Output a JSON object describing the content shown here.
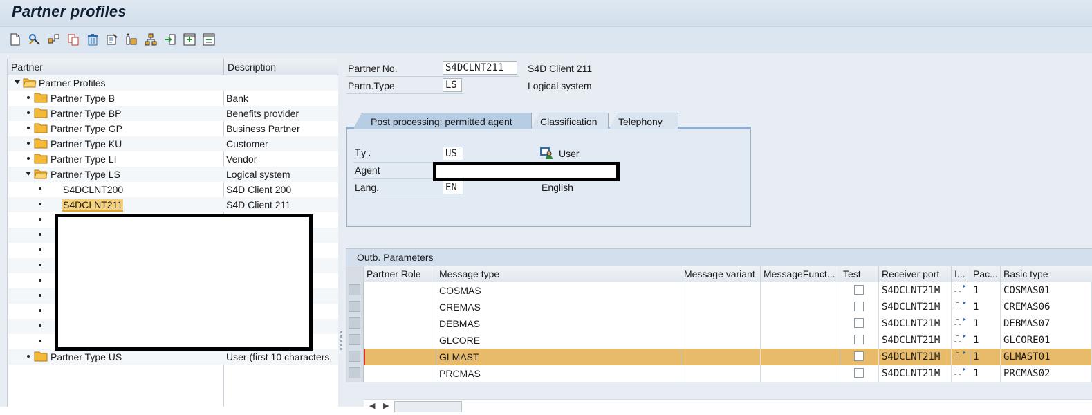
{
  "window": {
    "title": "Partner profiles"
  },
  "toolbar": {
    "buttons": [
      "create-icon",
      "change-icon",
      "display-icon",
      "copy-icon",
      "delete-icon",
      "check-icon",
      "info-icon",
      "hierarchy-icon",
      "import-icon",
      "expand-icon",
      "collapse-icon"
    ]
  },
  "tree": {
    "col_partner": "Partner",
    "col_description": "Description",
    "root": "Partner Profiles",
    "items": [
      {
        "label": "Partner Type B",
        "desc": "Bank"
      },
      {
        "label": "Partner Type BP",
        "desc": "Benefits provider"
      },
      {
        "label": "Partner Type GP",
        "desc": "Business Partner"
      },
      {
        "label": "Partner Type KU",
        "desc": "Customer"
      },
      {
        "label": "Partner Type LI",
        "desc": "Vendor"
      },
      {
        "label": "Partner Type LS",
        "desc": "Logical system"
      },
      {
        "label": "Partner Type US",
        "desc": "User (first 10 characters,"
      }
    ],
    "ls_children": [
      {
        "label": "S4DCLNT200",
        "desc": "S4D Client 200"
      },
      {
        "label": "S4DCLNT211",
        "desc": "S4D Client 211"
      }
    ]
  },
  "header": {
    "partner_no_label": "Partner No.",
    "partner_no_value": "S4DCLNT211",
    "partner_no_text": "S4D Client 211",
    "partn_type_label": "Partn.Type",
    "partn_type_value": "LS",
    "partn_type_text": "Logical system"
  },
  "tabs": {
    "items": [
      "Post processing: permitted agent",
      "Classification",
      "Telephony"
    ],
    "active": 0
  },
  "agent": {
    "ty_label": "Ty.",
    "ty_value": "US",
    "ty_text": "User",
    "agent_label": "Agent",
    "lang_label": "Lang.",
    "lang_value": "EN",
    "lang_text": "English"
  },
  "outbound": {
    "title": "Outb. Parameters",
    "columns": [
      "Partner Role",
      "Message type",
      "Message variant",
      "MessageFunct...",
      "Test",
      "Receiver port",
      "I...",
      "Pac...",
      "Basic type"
    ],
    "rows": [
      {
        "message_type": "COSMAS",
        "port": "S4DCLNT21M",
        "pack": "1",
        "basic": "COSMAS01"
      },
      {
        "message_type": "CREMAS",
        "port": "S4DCLNT21M",
        "pack": "1",
        "basic": "CREMAS06"
      },
      {
        "message_type": "DEBMAS",
        "port": "S4DCLNT21M",
        "pack": "1",
        "basic": "DEBMAS07"
      },
      {
        "message_type": "GLCORE",
        "port": "S4DCLNT21M",
        "pack": "1",
        "basic": "GLCORE01"
      },
      {
        "message_type": "GLMAST",
        "port": "S4DCLNT21M",
        "pack": "1",
        "basic": "GLMAST01"
      },
      {
        "message_type": "PRCMAS",
        "port": "S4DCLNT21M",
        "pack": "1",
        "basic": "PRCMAS02"
      }
    ],
    "selected_row": 4
  },
  "colors": {
    "selection": "#e8bb6b",
    "tree_selection": "#f7d27a",
    "tab_active": "#b7cde4",
    "background": "#e7edf3"
  }
}
